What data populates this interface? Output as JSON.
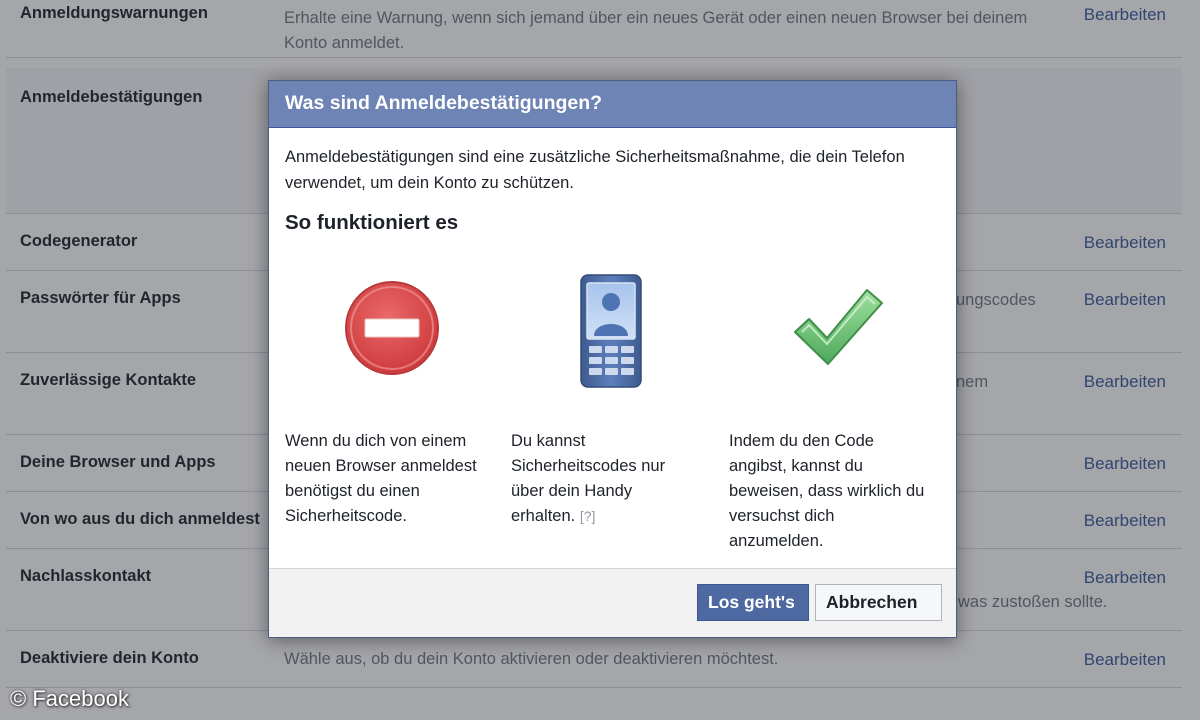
{
  "settings": {
    "edit_label": "Bearbeiten",
    "rows": [
      {
        "title": "Anmeldungswarnungen",
        "desc": "Erhalte eine Warnung, wenn sich jemand über ein neues Gerät oder einen neuen Browser bei deinem Konto anmeldet."
      },
      {
        "title": "Anmeldebestätigungen",
        "desc": ""
      },
      {
        "title": "Codegenerator",
        "desc": ""
      },
      {
        "title": "Passwörter für Apps",
        "desc": "ungscodes"
      },
      {
        "title": "Zuverlässige Kontakte",
        "desc": "nem"
      },
      {
        "title": "Deine Browser und Apps",
        "desc": ""
      },
      {
        "title": "Von wo aus du dich anmeldest",
        "desc": ""
      },
      {
        "title": "Nachlasskontakt",
        "desc": "was zustoßen sollte."
      },
      {
        "title": "Deaktiviere dein Konto",
        "desc": "Wähle aus, ob du dein Konto aktivieren oder deaktivieren möchtest."
      }
    ]
  },
  "dialog": {
    "title": "Was sind Anmeldebestätigungen?",
    "intro": "Anmeldebestätigungen sind eine zusätzliche Sicherheitsmaßnahme, die dein Telefon verwendet, um dein Konto zu schützen.",
    "subtitle": "So funktioniert es",
    "steps": [
      {
        "icon": "stop-icon",
        "text": "Wenn du dich von einem neuen Browser anmeldest benötigst du einen Sicherheitscode."
      },
      {
        "icon": "phone-icon",
        "text": "Du kannst Sicherheitscodes nur über dein Handy erhalten.",
        "help": "[?]"
      },
      {
        "icon": "checkmark-icon",
        "text": "Indem du den Code angibst, kannst du beweisen, dass wirklich du versuchst dich anzumelden."
      }
    ],
    "primary_button": "Los geht's",
    "cancel_button": "Abbrechen"
  },
  "watermark": "© Facebook",
  "colors": {
    "header_blue": "#6d84b4",
    "link_blue": "#365899",
    "button_blue": "#4e69a2",
    "stop_red": "#d9484a",
    "check_green": "#6cc070"
  }
}
